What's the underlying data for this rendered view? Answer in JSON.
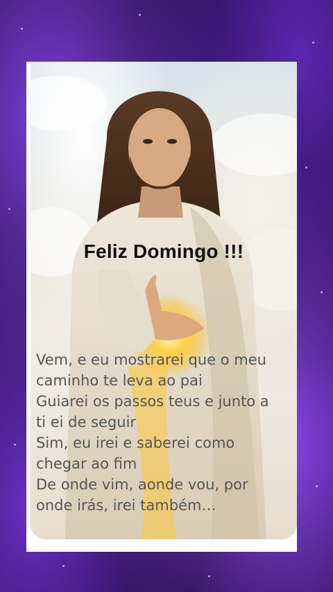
{
  "greeting": "Feliz Domingo !!!",
  "verse_lines": [
    "Vem, e eu mostrarei que o meu",
    "caminho te leva ao pai",
    "Guiarei os passos teus e junto a",
    "ti ei de seguir",
    "Sim, eu irei e saberei como",
    "chegar ao fim",
    "De onde vim, aonde vou, por",
    "onde irás, irei também…"
  ],
  "colors": {
    "background_purple": "#5a27b0",
    "text_dark": "#111111",
    "text_gray": "#555555"
  }
}
